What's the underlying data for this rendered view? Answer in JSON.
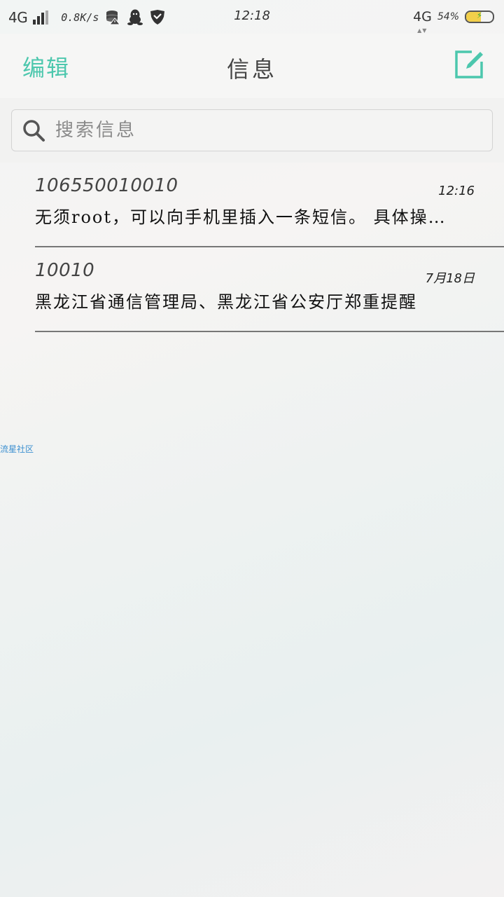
{
  "status_bar": {
    "network_left": "4G",
    "speed": "0.8K/s",
    "time": "12:18",
    "network_right": "4G",
    "battery_percent": "54%",
    "battery_level": 0.54,
    "icons": [
      "signal-icon",
      "data-icon",
      "qq-icon",
      "vpn-shield-icon",
      "battery-icon"
    ]
  },
  "header": {
    "edit_label": "编辑",
    "title": "信息",
    "compose_icon": "compose-icon",
    "accent_color": "#4cc7ad"
  },
  "search": {
    "placeholder": "搜索信息",
    "icon": "search-icon"
  },
  "messages": [
    {
      "sender": "106550010010",
      "time": "12:16",
      "preview": "无须root，可以向手机里插入一条短信。 具体操作步骤"
    },
    {
      "sender": "10010",
      "time": "7月18日",
      "preview": "黑龙江省通信管理局、黑龙江省公安厅郑重提醒"
    }
  ],
  "watermark": "流星社区"
}
